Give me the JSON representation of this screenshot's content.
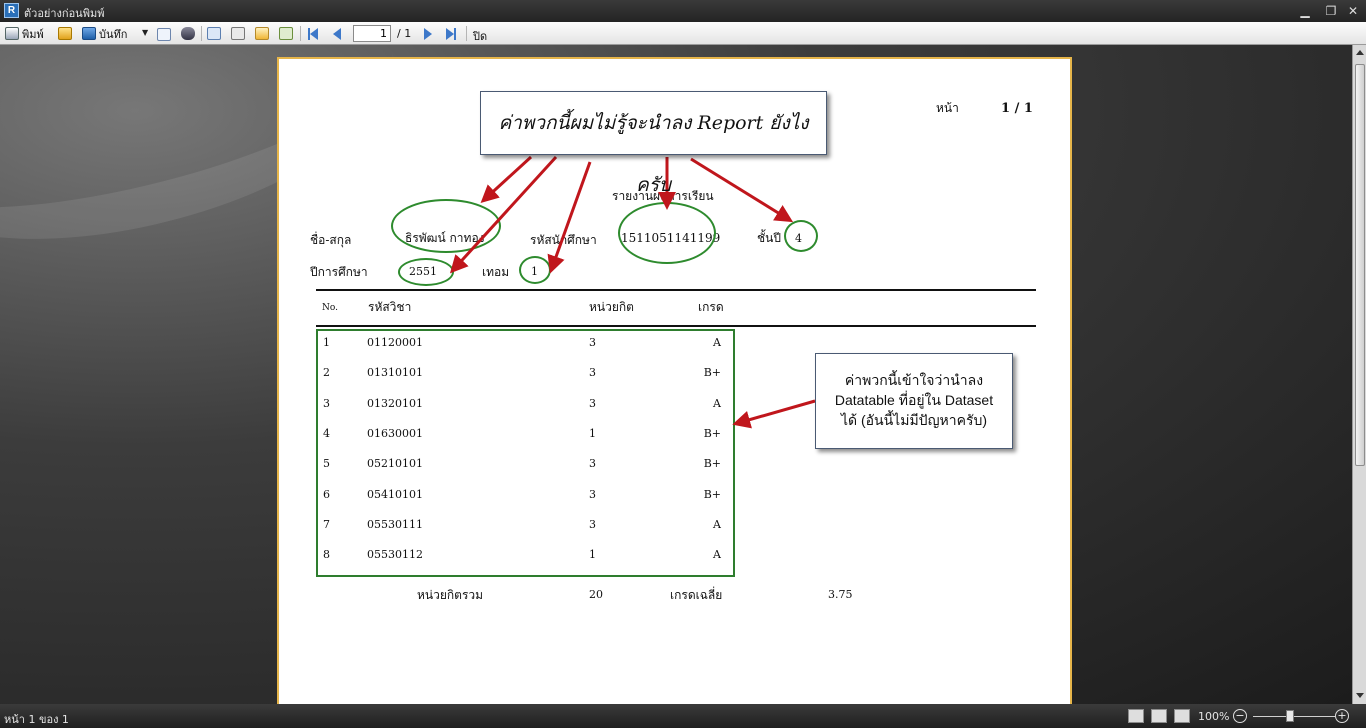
{
  "window": {
    "icon_letter": "R",
    "title": "ตัวอย่างก่อนพิมพ์",
    "minimize": "▁",
    "restore": "❐",
    "close": "✕"
  },
  "toolbar": {
    "print_label": "พิมพ์",
    "save_label": "บันทึก",
    "page_value": "1",
    "page_total": "/ 1",
    "close_label": "ปิด"
  },
  "report": {
    "page_label": "หน้า",
    "page_value": "1 / 1",
    "title": "รายงานผลการเรียน",
    "name_label": "ชื่อ-สกุล",
    "name_value": "ธิรพัฒน์ กาทอง",
    "student_id_label": "รหัสนักศึกษา",
    "student_id_value": "1511051141199",
    "year_label": "ชั้นปี",
    "year_value": "4",
    "academic_year_label": "ปีการศึกษา",
    "academic_year_value": "2551",
    "term_label": "เทอม",
    "term_value": "1",
    "columns": {
      "no": "No.",
      "code": "รหัสวิชา",
      "credit": "หน่วยกิต",
      "grade": "เกรด"
    },
    "rows": [
      {
        "no": "1",
        "code": "01120001",
        "credit": "3",
        "grade": "A"
      },
      {
        "no": "2",
        "code": "01310101",
        "credit": "3",
        "grade": "B+"
      },
      {
        "no": "3",
        "code": "01320101",
        "credit": "3",
        "grade": "A"
      },
      {
        "no": "4",
        "code": "01630001",
        "credit": "1",
        "grade": "B+"
      },
      {
        "no": "5",
        "code": "05210101",
        "credit": "3",
        "grade": "B+"
      },
      {
        "no": "6",
        "code": "05410101",
        "credit": "3",
        "grade": "B+"
      },
      {
        "no": "7",
        "code": "05530111",
        "credit": "3",
        "grade": "A"
      },
      {
        "no": "8",
        "code": "05530112",
        "credit": "1",
        "grade": "A"
      }
    ],
    "total_credit_label": "หน่วยกิตรวม",
    "total_credit_value": "20",
    "gpa_label": "เกรดเฉลี่ย",
    "gpa_value": "3.75"
  },
  "annotations": {
    "callout_top": "ค่าพวกนี้ผมไม่รู้จะนำลง Report ยังไงครับ",
    "callout_right_line1": "ค่าพวกนี้เข้าใจว่านำลง",
    "callout_right_line2": "Datatable ที่อยู่ใน Dataset",
    "callout_right_line3": "ได้ (อันนี้ไม่มีปัญหาครับ)",
    "arrow_color": "#c0161c",
    "ring_color": "#2e8b2e"
  },
  "statusbar": {
    "page_info": "หน้า 1 ของ 1",
    "zoom": "100%",
    "zoom_out": "−",
    "zoom_in": "+"
  }
}
